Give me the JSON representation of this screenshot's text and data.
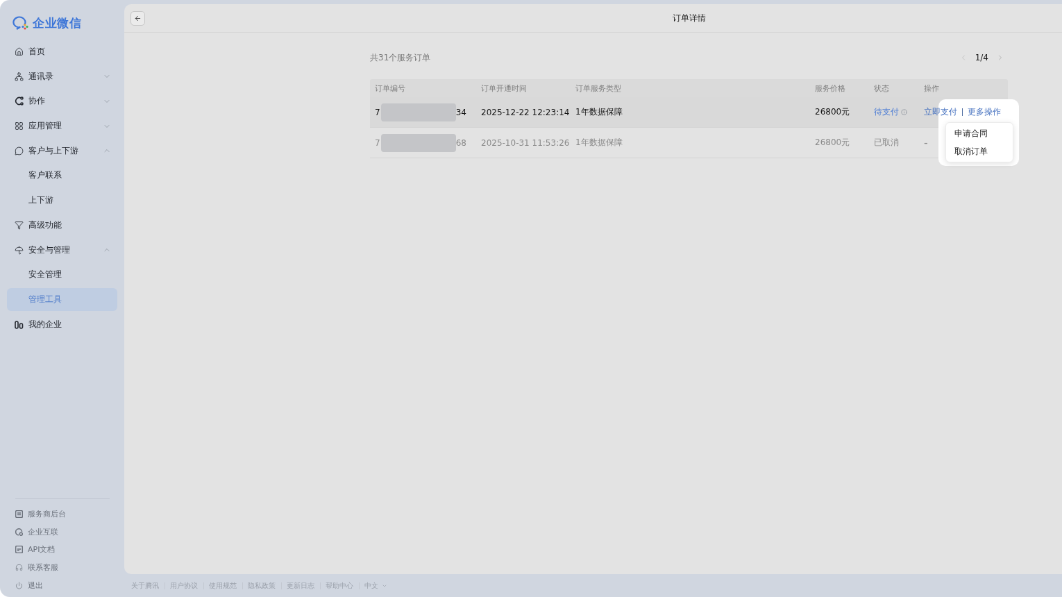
{
  "sidebar": {
    "logo": "企业微信",
    "items": [
      {
        "label": "首页",
        "selected": false
      },
      {
        "label": "通讯录",
        "selected": false,
        "expanded": false
      },
      {
        "label": "协作",
        "selected": false,
        "expanded": false
      },
      {
        "label": "应用管理",
        "selected": false,
        "expanded": false
      },
      {
        "label": "客户与上下游",
        "selected": false,
        "expanded": true,
        "children": [
          {
            "label": "客户联系",
            "selected": false
          },
          {
            "label": "上下游",
            "selected": false
          }
        ]
      },
      {
        "label": "高级功能",
        "selected": false
      },
      {
        "label": "安全与管理",
        "selected": false,
        "expanded": true,
        "children": [
          {
            "label": "安全管理",
            "selected": false
          },
          {
            "label": "管理工具",
            "selected": true
          }
        ]
      },
      {
        "label": "我的企业",
        "selected": false
      }
    ],
    "bottom_links": [
      "服务商后台",
      "企业互联",
      "API文档",
      "联系客服",
      "退出"
    ]
  },
  "header": {
    "title": "订单详情"
  },
  "summary": "共31个服务订单",
  "pagination": {
    "page": "1/4"
  },
  "table": {
    "columns": [
      "订单编号",
      "订单开通时间",
      "订单服务类型",
      "服务价格",
      "状态",
      "操作"
    ],
    "rows": [
      {
        "order_no": {
          "prefix": "7",
          "suffix": "34"
        },
        "opened_at": "2025-12-22 12:23:14",
        "service_type": "1年数据保障",
        "price": "26800元",
        "status": {
          "kind": "pending",
          "label": "待支付"
        },
        "highlighted": true,
        "actions": [
          {
            "kind": "link",
            "label": "立即支付"
          },
          {
            "kind": "menu",
            "label": "更多操作",
            "expanded": true,
            "menu": [
              "申请合同",
              "取消订单"
            ]
          }
        ]
      },
      {
        "order_no": {
          "prefix": "7",
          "suffix": "68"
        },
        "opened_at": "2025-10-31 11:53:26",
        "service_type": "1年数据保障",
        "price": "26800元",
        "status": {
          "kind": "cancelled",
          "label": "已取消"
        },
        "highlighted": false,
        "actions": [
          {
            "kind": "text",
            "label": "-"
          }
        ]
      }
    ]
  },
  "footer": {
    "links": [
      "关于腾讯",
      "用户协议",
      "使用规范",
      "隐私政策",
      "更新日志",
      "帮助中心"
    ],
    "language": "中文"
  }
}
